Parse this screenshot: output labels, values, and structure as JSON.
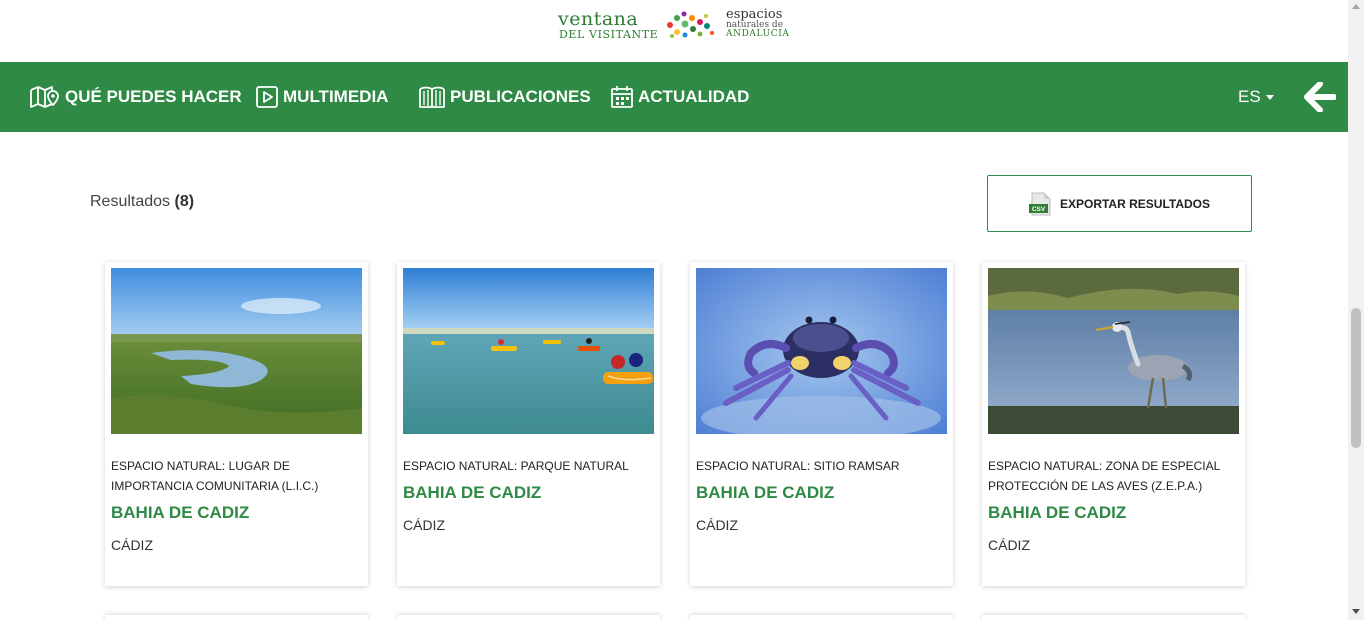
{
  "logo": {
    "line1": "ventana",
    "line2": "DEL VISITANTE",
    "line3": "espacios",
    "line4": "naturales de",
    "line5": "ANDALUCIA"
  },
  "nav": {
    "items": [
      {
        "label": "QUÉ PUEDES HACER",
        "icon": "map-pin-icon"
      },
      {
        "label": "MULTIMEDIA",
        "icon": "play-icon"
      },
      {
        "label": "PUBLICACIONES",
        "icon": "book-icon"
      },
      {
        "label": "ACTUALIDAD",
        "icon": "calendar-icon"
      }
    ],
    "language": "ES",
    "back_icon": "arrow-left-icon"
  },
  "results": {
    "label": "Resultados",
    "count": "(8)"
  },
  "export": {
    "label": "EXPORTAR RESULTADOS",
    "icon_text": "CSV"
  },
  "cards": [
    {
      "category": "ESPACIO NATURAL: LUGAR DE IMPORTANCIA COMUNITARIA (L.I.C.)",
      "title": "BAHIA DE CADIZ",
      "province": "CÁDIZ",
      "image": "marsh-landscape"
    },
    {
      "category": "ESPACIO NATURAL: PARQUE NATURAL",
      "title": "BAHIA DE CADIZ",
      "province": "CÁDIZ",
      "image": "kayakers-on-water"
    },
    {
      "category": "ESPACIO NATURAL: SITIO RAMSAR",
      "title": "BAHIA DE CADIZ",
      "province": "CÁDIZ",
      "image": "fiddler-crab"
    },
    {
      "category": "ESPACIO NATURAL: ZONA DE ESPECIAL PROTECCIÓN DE LAS AVES (Z.E.P.A.)",
      "title": "BAHIA DE CADIZ",
      "province": "CÁDIZ",
      "image": "grey-heron"
    }
  ],
  "colors": {
    "nav_green": "#2e8a45",
    "title_green": "#2e8a45"
  }
}
